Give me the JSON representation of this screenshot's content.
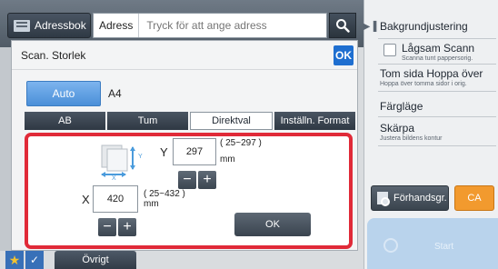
{
  "topbar": {
    "address_book_label": "Adressbok",
    "address_label": "Adress",
    "address_placeholder": "Tryck för att ange adress"
  },
  "right_panel": {
    "items": [
      {
        "title": "Bakgrundjustering",
        "subtitle": ""
      },
      {
        "title": "Lågsam Scann",
        "subtitle": "Scanna tunt pappersorig."
      },
      {
        "title": "Tom sida Hoppa över",
        "subtitle": "Hoppa över tomma sidor i orig."
      },
      {
        "title": "Färgläge",
        "subtitle": ""
      },
      {
        "title": "Skärpa",
        "subtitle": "Justera bildens kontur"
      }
    ],
    "preview_label": "Förhandsgr.",
    "ca_label": "CA",
    "start_label": "Start"
  },
  "dialog": {
    "title": "Scan. Storlek",
    "ok_badge": "OK",
    "auto_label": "Auto",
    "auto_value": "A4",
    "tabs": [
      "AB",
      "Tum",
      "Direktval",
      "Inställn. Format"
    ],
    "active_tab": "Direktval",
    "y_label": "Y",
    "y_value": "297",
    "y_range": "( 25~297 )",
    "y_unit": "mm",
    "x_label": "X",
    "x_value": "420",
    "x_range": "( 25~432 )",
    "x_unit": "mm",
    "minus": "−",
    "plus": "+",
    "ok_button": "OK",
    "icon_y": "Y",
    "icon_x": "X"
  },
  "bottom": {
    "ovrigt_label": "Övrigt"
  },
  "colors": {
    "highlight": "#e02a38",
    "accent_blue": "#1f6fd0",
    "ca_orange": "#f29a2e"
  }
}
